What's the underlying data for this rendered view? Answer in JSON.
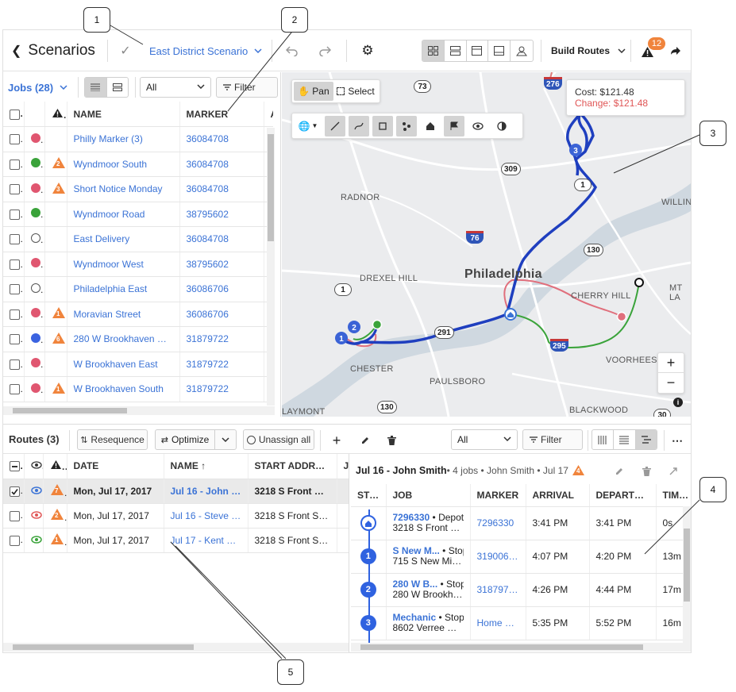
{
  "header": {
    "back_label": "Scenarios",
    "scenario_name": "East District Scenario",
    "build_routes_label": "Build Routes",
    "alert_count": "12"
  },
  "jobs": {
    "title": "Jobs (28)",
    "filter_select": "All",
    "filter_label": "Filter",
    "columns": [
      "NAME",
      "MARKER",
      "A"
    ],
    "rows": [
      {
        "status": "red",
        "warn": "",
        "name": "Philly Marker (3)",
        "marker": "36084708"
      },
      {
        "status": "green",
        "warn": "2",
        "name": "Wyndmoor South",
        "marker": "36084708"
      },
      {
        "status": "red",
        "warn": "3",
        "name": "Short Notice Monday",
        "marker": "36084708"
      },
      {
        "status": "green",
        "warn": "",
        "name": "Wyndmoor Road",
        "marker": "38795602"
      },
      {
        "status": "empty",
        "warn": "",
        "name": "East Delivery",
        "marker": "36084708"
      },
      {
        "status": "red",
        "warn": "",
        "name": "Wyndmoor West",
        "marker": "38795602"
      },
      {
        "status": "empty",
        "warn": "",
        "name": "Philadelphia East",
        "marker": "36086706"
      },
      {
        "status": "red",
        "warn": "1",
        "name": "Moravian Street",
        "marker": "36086706"
      },
      {
        "status": "blue",
        "warn": "6",
        "name": "280 W Brookhaven Rd, ...",
        "marker": "31879722"
      },
      {
        "status": "red",
        "warn": "",
        "name": "W Brookhaven East",
        "marker": "31879722"
      },
      {
        "status": "red",
        "warn": "1",
        "name": "W Brookhaven South",
        "marker": "31879722"
      }
    ]
  },
  "map": {
    "pan_label": "Pan",
    "select_label": "Select",
    "cost_label": "Cost: $121.48",
    "change_label": "Change: $121.48",
    "zoom_in": "+",
    "zoom_out": "−",
    "places": [
      "RADNOR",
      "DREXEL HILL",
      "Philadelphia",
      "CHERRY HILL",
      "CHESTER",
      "VOORHEES",
      "PAULSBORO",
      "BLACKWOOD",
      "WILLING",
      "MT LA",
      "LAYMONT"
    ],
    "shields": [
      "73",
      "276",
      "309",
      "1",
      "76",
      "130",
      "1",
      "291",
      "295",
      "130",
      "30"
    ],
    "route_stops": [
      "1",
      "2",
      "3"
    ]
  },
  "routes": {
    "title": "Routes (3)",
    "resequence_label": "Resequence",
    "optimize_label": "Optimize",
    "unassign_label": "Unassign all",
    "filter_select": "All",
    "filter_label": "Filter",
    "columns": [
      "DATE",
      "NAME ↑",
      "START ADDRESS",
      "J"
    ],
    "rows": [
      {
        "checked": true,
        "eye": "#3b73d6",
        "warn": "7",
        "date": "Mon, Jul 17, 2017",
        "name": "Jul 16 - John S...",
        "address": "3218 S Front St,..."
      },
      {
        "checked": false,
        "eye": "#e05656",
        "warn": "2",
        "date": "Mon, Jul 17, 2017",
        "name": "Jul 16 - Steve M...",
        "address": "3218 S Front St,..."
      },
      {
        "checked": false,
        "eye": "#3aa33a",
        "warn": "1",
        "date": "Mon, Jul 17, 2017",
        "name": "Jul 17 - Kent Br...",
        "address": "3218 S Front St,..."
      }
    ]
  },
  "route_detail": {
    "title": "Jul 16 - John Smith",
    "subtitle": " • 4 jobs • John Smith • Jul 17",
    "warn": "4",
    "columns": [
      "STOP",
      "JOB",
      "MARKER",
      "ARRIVAL",
      "DEPARTURE",
      "TIME ON"
    ],
    "stops": [
      {
        "num": "",
        "job_link": "7296330",
        "job_type": " • Depot",
        "address": "3218 S Front St,...",
        "marker": "7296330",
        "arrival": "3:41 PM",
        "departure": "3:41 PM",
        "time_on": "0s"
      },
      {
        "num": "1",
        "job_link": "S New M...",
        "job_type": " • Stop",
        "address": "715 S New Mid...",
        "marker": "31900642",
        "arrival": "4:07 PM",
        "departure": "4:20 PM",
        "time_on": "13m"
      },
      {
        "num": "2",
        "job_link": "280 W B...",
        "job_type": " • Stop",
        "address": "280 W Brookha...",
        "marker": "31879722",
        "arrival": "4:26 PM",
        "departure": "4:44 PM",
        "time_on": "17m"
      },
      {
        "num": "3",
        "job_link": "Mechanic",
        "job_type": " • Stop",
        "address": "8602 Verree Rd,...",
        "marker": "Home D...",
        "arrival": "5:35 PM",
        "departure": "5:52 PM",
        "time_on": "16m"
      }
    ]
  },
  "callouts": [
    "1",
    "2",
    "3",
    "4",
    "5"
  ],
  "colors": {
    "accent": "#3b73d6",
    "warn": "#f0843c",
    "red": "#e05670",
    "green": "#3aa33a",
    "route": "#1f3fbf"
  }
}
